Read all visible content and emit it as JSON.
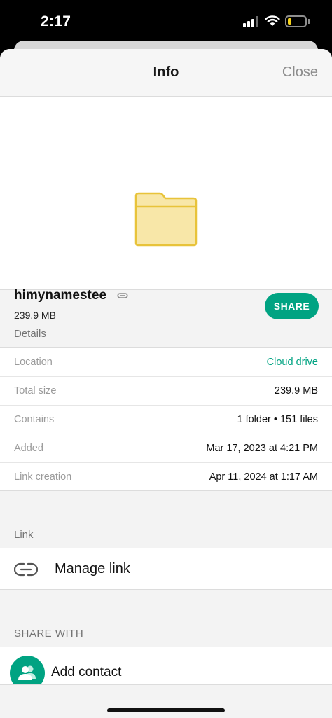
{
  "status_bar": {
    "time": "2:17",
    "battery_level": 0.2,
    "battery_color": "#f5d21a"
  },
  "nav": {
    "title": "Info",
    "close_label": "Close"
  },
  "file": {
    "name": "himynamestee",
    "size": "239.9 MB",
    "icon": "folder-icon",
    "share_label": "SHARE"
  },
  "details": {
    "section_label": "Details",
    "rows": [
      {
        "label": "Location",
        "value": "Cloud drive"
      },
      {
        "label": "Total size",
        "value": "239.9 MB"
      },
      {
        "label": "Contains",
        "value": "1 folder • 151 files"
      },
      {
        "label": "Added",
        "value": "Mar 17, 2023 at 4:21 PM"
      },
      {
        "label": "Link creation",
        "value": "Apr 11, 2024 at 1:17 AM"
      }
    ]
  },
  "link": {
    "section_label": "Link",
    "manage_label": "Manage link"
  },
  "share_with": {
    "section_label": "SHARE WITH",
    "add_contact_label": "Add contact"
  },
  "colors": {
    "accent": "#00a382",
    "folder": "#f8e7a8",
    "folder_outline": "#e8c33a"
  }
}
